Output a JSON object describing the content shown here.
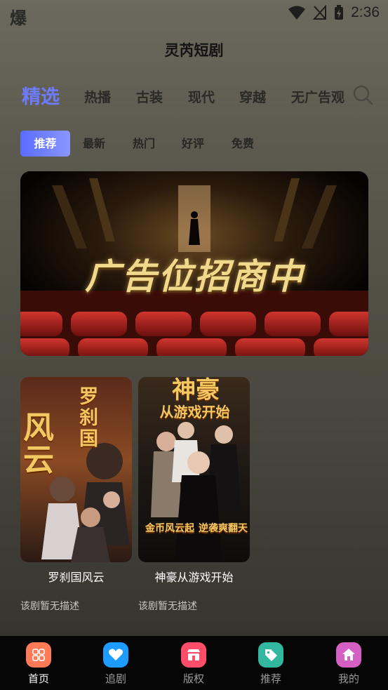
{
  "status_bar": {
    "left_text": "爆",
    "time": "2:36"
  },
  "app": {
    "title": "灵芮短剧"
  },
  "category_tabs": [
    {
      "label": "精选",
      "active": true
    },
    {
      "label": "热播",
      "active": false
    },
    {
      "label": "古装",
      "active": false
    },
    {
      "label": "现代",
      "active": false
    },
    {
      "label": "穿越",
      "active": false
    },
    {
      "label": "无广告观",
      "active": false
    }
  ],
  "sub_tabs": [
    {
      "label": "推荐",
      "active": true
    },
    {
      "label": "最新",
      "active": false
    },
    {
      "label": "热门",
      "active": false
    },
    {
      "label": "好评",
      "active": false
    },
    {
      "label": "免费",
      "active": false
    }
  ],
  "banner": {
    "text": "广告位招商中"
  },
  "dramas": [
    {
      "title": "罗刹国风云",
      "description": "该剧暂无描述",
      "poster_big": "风云",
      "poster_side": "罗刹国"
    },
    {
      "title": "神豪从游戏开始",
      "description": "该剧暂无描述",
      "poster_big": "神豪",
      "poster_sub": "从游戏开始",
      "poster_bottom_a": "金币风云起",
      "poster_bottom_b": "逆袭爽翻天"
    }
  ],
  "bottom_nav": [
    {
      "label": "首页",
      "icon": "home-grid-icon",
      "color": "#ff7a57",
      "active": true
    },
    {
      "label": "追剧",
      "icon": "heart-icon",
      "color": "#1e9bff",
      "active": false
    },
    {
      "label": "版权",
      "icon": "store-icon",
      "color": "#ff4d6a",
      "active": false
    },
    {
      "label": "推荐",
      "icon": "tag-icon",
      "color": "#33b8a0",
      "active": false
    },
    {
      "label": "我的",
      "icon": "house-icon",
      "color": "#d65fc5",
      "active": false
    }
  ]
}
